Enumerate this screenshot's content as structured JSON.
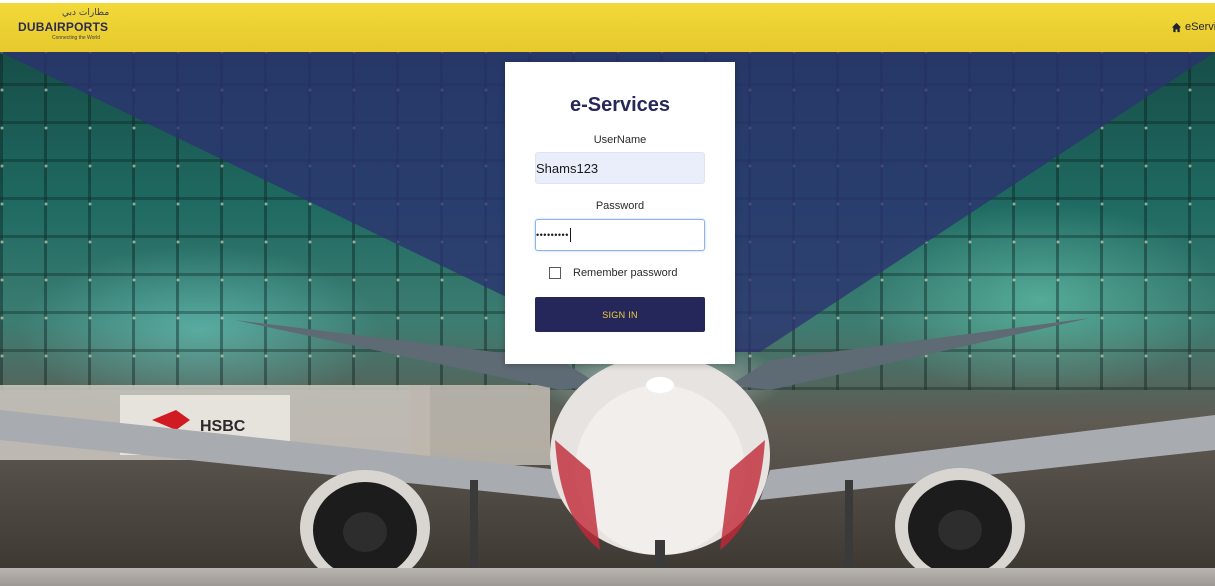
{
  "header": {
    "logo_arabic": "مطارات دبي",
    "logo_main": "DUBAIRPORTS",
    "logo_sub": "Connecting the World",
    "home_link": "eServi",
    "home_icon": "home-icon"
  },
  "login": {
    "title": "e-Services",
    "username_label": "UserName",
    "username_value": "Shams123",
    "password_label": "Password",
    "password_value": "•••••••••",
    "remember_label": "Remember password",
    "remember_checked": false,
    "signin_label": "SIGN IN"
  },
  "background": {
    "sign_text": "HSBC"
  },
  "colors": {
    "header_yellow": "#f0d43a",
    "overlay_navy": "#2b3271",
    "button_navy": "#25275a",
    "button_text": "#f0d03a",
    "title_navy": "#27285a"
  }
}
